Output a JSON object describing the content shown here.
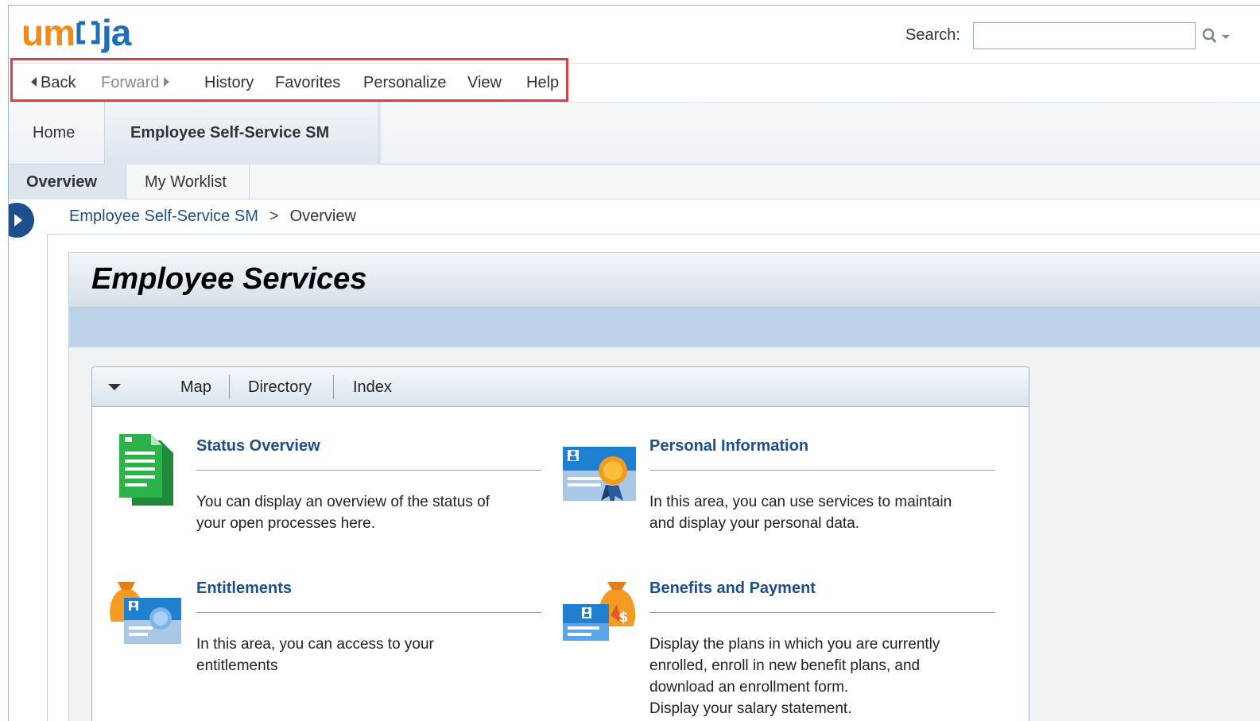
{
  "header": {
    "logo": {
      "part1": "um",
      "part2": " ",
      "part3": "ja"
    },
    "search_label": "Search:",
    "search_value": "",
    "search_icon": "search-icon"
  },
  "navbar": {
    "back": "Back",
    "forward": "Forward",
    "history": "History",
    "favorites": "Favorites",
    "personalize": "Personalize",
    "view": "View",
    "help": "Help"
  },
  "tabs": {
    "home": "Home",
    "ess": "Employee Self-Service SM"
  },
  "subtabs": {
    "overview": "Overview",
    "worklist": "My Worklist"
  },
  "breadcrumb": {
    "root": "Employee Self-Service SM",
    "separator": ">",
    "current": "Overview"
  },
  "page": {
    "title": "Employee Services"
  },
  "panel": {
    "tabs": [
      "Map",
      "Directory",
      "Index"
    ],
    "services": [
      {
        "title": "Status Overview",
        "desc_lines": [
          "You can display an overview of the status of",
          "your open processes here."
        ],
        "icon": "document-stack-icon"
      },
      {
        "title": "Personal Information",
        "desc_lines": [
          "In this area, you can use services to maintain",
          "and display your personal data."
        ],
        "icon": "id-card-award-icon"
      },
      {
        "title": "Entitlements",
        "desc_lines": [
          "In this area, you can access to your",
          "entitlements"
        ],
        "icon": "money-bag-certificate-icon"
      },
      {
        "title": "Benefits and Payment",
        "desc_lines": [
          "Display the plans in which you are currently",
          "enrolled, enroll in new benefit plans, and",
          "download an enrollment form.",
          "Display your salary statement."
        ],
        "icon": "id-card-money-bag-icon"
      }
    ]
  },
  "colors": {
    "accent": "#1d4f8e",
    "logo_orange": "#f08a1c",
    "logo_blue": "#1d6fb8",
    "highlight": "#d94045"
  }
}
